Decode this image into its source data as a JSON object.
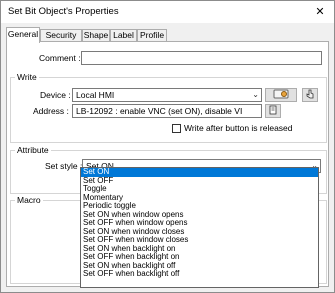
{
  "window": {
    "title": "Set Bit Object's Properties",
    "close_glyph": "✕"
  },
  "tabs": [
    {
      "label": "General",
      "active": true
    },
    {
      "label": "Security",
      "active": false
    },
    {
      "label": "Shape",
      "active": false
    },
    {
      "label": "Label",
      "active": false
    },
    {
      "label": "Profile",
      "active": false
    }
  ],
  "comment": {
    "label": "Comment :",
    "value": ""
  },
  "write": {
    "title": "Write",
    "device_label": "Device :",
    "device_value": "Local HMI",
    "address_label": "Address :",
    "address_value": "LB-12092 : enable VNC (set ON), disable VI",
    "write_after_label": "Write after button is released",
    "write_after_checked": false
  },
  "attribute": {
    "title": "Attribute",
    "set_style_label": "Set style :",
    "set_style_value": "Set ON",
    "options": [
      "Set ON",
      "Set OFF",
      "Toggle",
      "Momentary",
      "Periodic toggle",
      "Set ON when window opens",
      "Set OFF when window opens",
      "Set ON when window closes",
      "Set OFF when window closes",
      "Set ON when backlight on",
      "Set OFF when backlight on",
      "Set ON when backlight off",
      "Set OFF when backlight off"
    ],
    "selected_index": 0
  },
  "macro": {
    "title": "Macro"
  },
  "icons": {
    "close": "close-icon",
    "dropdown": "chevron-down-icon",
    "settings": "device-settings-icon",
    "address_book": "address-book-icon"
  }
}
